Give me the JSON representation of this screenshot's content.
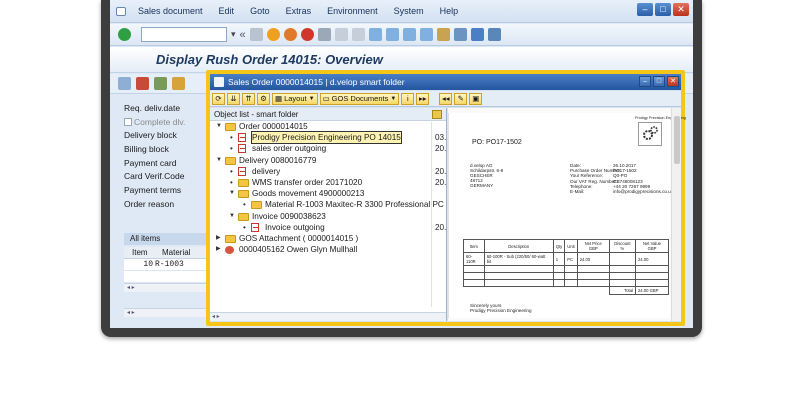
{
  "menu": {
    "items": [
      "Sales document",
      "Edit",
      "Goto",
      "Extras",
      "Environment",
      "System",
      "Help"
    ]
  },
  "window_title": "Display Rush Order 14015: Overview",
  "form": {
    "labels": [
      "Req. deliv.date",
      "Complete dlv.",
      "Delivery block",
      "Billing block",
      "Payment card",
      "Card Verif.Code",
      "Payment terms",
      "Order reason"
    ]
  },
  "items_tab": "All items",
  "item_grid": {
    "headers": [
      "Item",
      "Material"
    ],
    "rows": [
      {
        "item": "10",
        "material": "R-1003"
      }
    ]
  },
  "popup": {
    "title": "Sales Order 0000014015  |  d.velop smart folder",
    "toolbar": {
      "layout_label": "Layout",
      "gos_label": "GOS Documents"
    },
    "object_list_header": "Object list - smart folder",
    "tree": [
      {
        "level": 0,
        "type": "folder",
        "expand": "down",
        "label": "Order 0000014015",
        "date": ""
      },
      {
        "level": 1,
        "type": "pdf",
        "label": "Prodigy Precision Engineering PO 14015",
        "date": "03.",
        "selected": true
      },
      {
        "level": 1,
        "type": "pdf",
        "label": "sales order outgoing",
        "date": "20."
      },
      {
        "level": 0,
        "type": "folder",
        "expand": "down",
        "label": "Delivery 0080016779",
        "date": ""
      },
      {
        "level": 1,
        "type": "pdf",
        "label": "delivery",
        "date": "20."
      },
      {
        "level": 1,
        "type": "folder",
        "label": "WMS transfer order 20171020",
        "date": "20."
      },
      {
        "level": 1,
        "type": "folder",
        "expand": "down",
        "label": "Goods movement 4900000213",
        "date": ""
      },
      {
        "level": 2,
        "type": "folder",
        "label": "Material R-1003 Maxitec-R 3300 Professional PC",
        "date": ""
      },
      {
        "level": 1,
        "type": "folder",
        "expand": "down",
        "label": "Invoice 0090038623",
        "date": ""
      },
      {
        "level": 2,
        "type": "pdf",
        "label": "Invoice outgoing",
        "date": "20."
      },
      {
        "level": 0,
        "type": "folder",
        "expand": "right",
        "label": "GOS Attachment ( 0000014015 )",
        "date": ""
      },
      {
        "level": 0,
        "type": "person",
        "expand": "right",
        "label": "0000405162 Owen Glyn Mullhall",
        "date": ""
      }
    ],
    "document": {
      "company": "Prodigy Precision Engineering",
      "po_title": "PO: PO17-1502",
      "address": [
        "d.velop AG",
        "Schildarpstr. 6-8",
        "GESCHER",
        "48712",
        "GERMANY"
      ],
      "meta": [
        {
          "k": "Date:",
          "v": "26.10.2017"
        },
        {
          "k": "Purchase Order Number:",
          "v": "PO17-1502"
        },
        {
          "k": "Your Reference:",
          "v": "Q0-PO"
        },
        {
          "k": "Our VAT Reg. Number:",
          "v": "GB746008123"
        },
        {
          "k": "Telephone:",
          "v": "+44 20 7267 9999"
        },
        {
          "k": "E-Mail:",
          "v": "info@prodigyprecisions.co.uk"
        }
      ],
      "table_headers": [
        "Item",
        "Description",
        "Qty",
        "Unit",
        "Net Price GBP",
        "Discount %",
        "Net Value GBP"
      ],
      "table_row": [
        "60-110R",
        "60-100R - Sub (220/50/ 60-watt bit",
        "1",
        "PC",
        "24.00",
        "",
        "24.00"
      ],
      "total_label": "Total",
      "total_value": "24.00 GBP",
      "closing": "Sincerely yours",
      "closing_company": "Prodigy Precision Engineering"
    }
  }
}
